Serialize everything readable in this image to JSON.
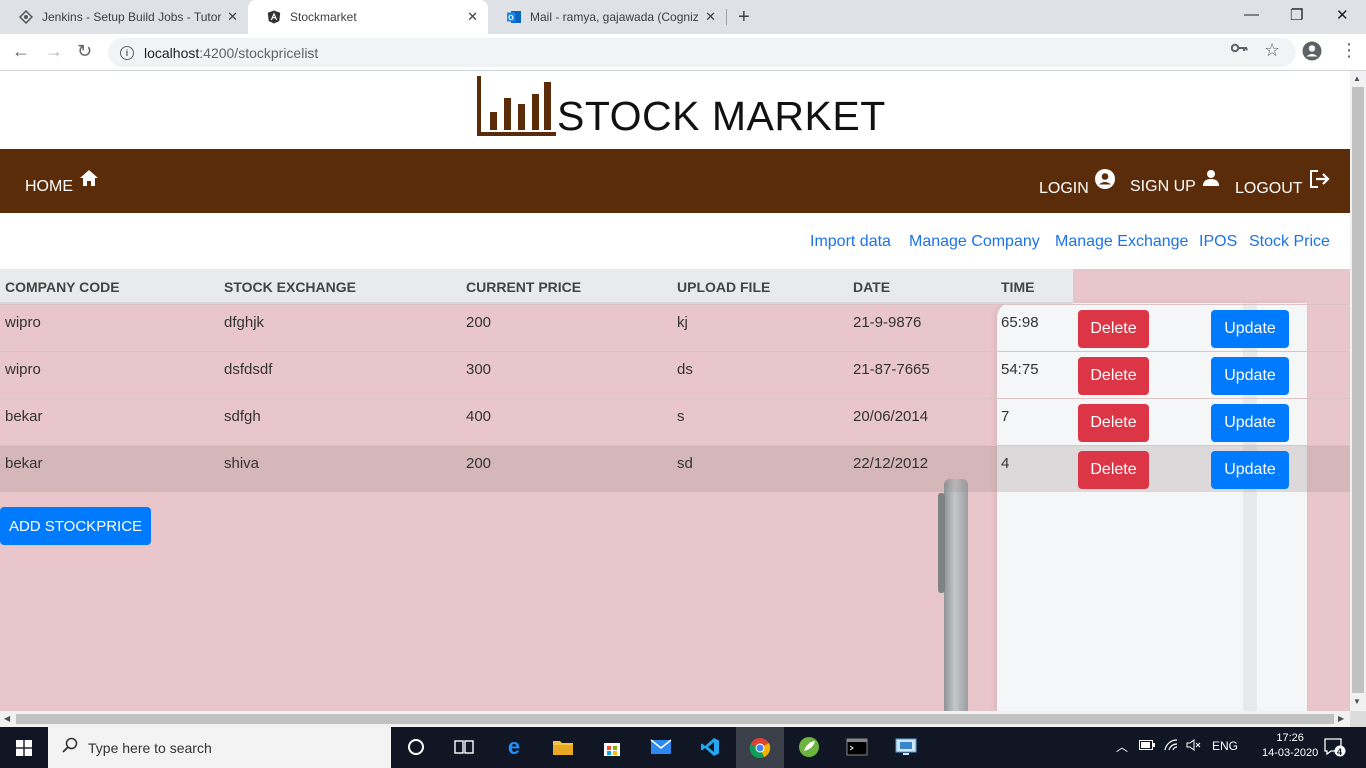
{
  "browser": {
    "tabs": [
      {
        "title": "Jenkins - Setup Build Jobs - Tutor",
        "icon": "jenkins-icon"
      },
      {
        "title": "Stockmarket",
        "icon": "angular-icon"
      },
      {
        "title": "Mail - ramya, gajawada (Cognizan",
        "icon": "outlook-icon"
      }
    ],
    "url_host": "localhost",
    "url_path": ":4200/stockpricelist"
  },
  "page": {
    "brand": "STOCK MARKET",
    "nav": {
      "home": "HOME",
      "login": "LOGIN",
      "signup": "SIGN UP",
      "logout": "LOGOUT"
    },
    "subnav": [
      "Import data",
      "Manage Company",
      "Manage Exchange",
      "IPOS",
      "Stock Price"
    ],
    "table": {
      "headers": [
        "COMPANY CODE",
        "STOCK EXCHANGE",
        "CURRENT PRICE",
        "UPLOAD FILE",
        "DATE",
        "TIME"
      ],
      "rows": [
        [
          "wipro",
          "dfghjk",
          "200",
          "kj",
          "21-9-9876",
          "65:98"
        ],
        [
          "wipro",
          "dsfdsdf",
          "300",
          "ds",
          "21-87-7665",
          "54:75"
        ],
        [
          "bekar",
          "sdfgh",
          "400",
          "s",
          "20/06/2014",
          "7"
        ],
        [
          "bekar",
          "shiva",
          "200",
          "sd",
          "22/12/2012",
          "4"
        ]
      ],
      "delete_label": "Delete",
      "update_label": "Update"
    },
    "add_button": "ADD STOCKPRICE",
    "colors": {
      "nav_bg": "#5a2c0a",
      "delete": "#dc3545",
      "update": "#007bff",
      "link": "#1a73e8"
    }
  },
  "taskbar": {
    "search_placeholder": "Type here to search",
    "language": "ENG",
    "time": "17:26",
    "date": "14-03-2020",
    "notifications": "4"
  }
}
